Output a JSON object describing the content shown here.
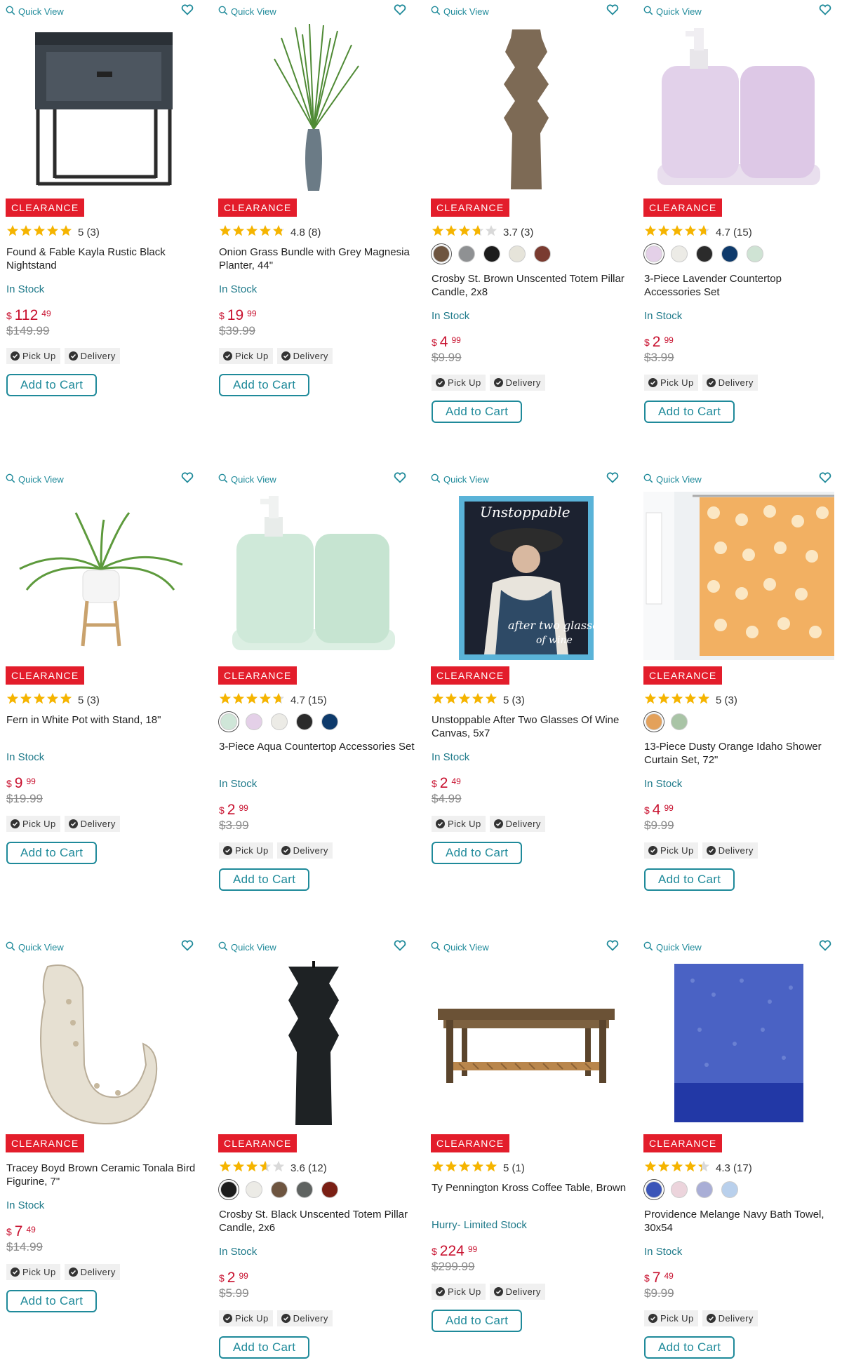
{
  "ui": {
    "quick_view": "Quick View",
    "badge": "CLEARANCE",
    "pickup": "Pick Up",
    "delivery": "Delivery",
    "add_to_cart": "Add to Cart",
    "currency": "$",
    "colors": {
      "accent": "#1f8a9a",
      "sale": "#e31d2b",
      "price": "#c8102e",
      "star": "#f5b400"
    }
  },
  "products": [
    {
      "name": "Found & Fable Kayla Rustic Black Nightstand",
      "rating": 5,
      "rating_text": "5 (3)",
      "swatches": [],
      "stock": "In Stock",
      "price_dollars": "112",
      "price_cents": "49",
      "was": "$149.99",
      "image": "nightstand"
    },
    {
      "name": "Onion Grass Bundle with Grey Magnesia Planter, 44\"",
      "rating": 4.8,
      "rating_text": "4.8 (8)",
      "swatches": [],
      "stock": "In Stock",
      "price_dollars": "19",
      "price_cents": "99",
      "was": "$39.99",
      "image": "grass"
    },
    {
      "name": "Crosby St. Brown Unscented Totem Pillar Candle, 2x8",
      "rating": 3.7,
      "rating_text": "3.7 (3)",
      "swatches": [
        "#6e5540",
        "#8f9193",
        "#1c1c1c",
        "#e6e4da",
        "#7a3b30"
      ],
      "stock": "In Stock",
      "price_dollars": "4",
      "price_cents": "99",
      "was": "$9.99",
      "image": "candle-brown"
    },
    {
      "name": "3-Piece Lavender Countertop Accessories Set",
      "rating": 4.7,
      "rating_text": "4.7 (15)",
      "swatches": [
        "#e4d0e8",
        "#ecebe6",
        "#2b2b2b",
        "#0e3a6b",
        "#cfe3d4"
      ],
      "stock": "In Stock",
      "price_dollars": "2",
      "price_cents": "99",
      "was": "$3.99",
      "image": "set-lavender"
    },
    {
      "name": "Fern in White Pot with Stand, 18\"",
      "rating": 5,
      "rating_text": "5 (3)",
      "swatches": [],
      "stock": "In Stock",
      "price_dollars": "9",
      "price_cents": "99",
      "was": "$19.99",
      "image": "fern"
    },
    {
      "name": "3-Piece Aqua Countertop Accessories Set",
      "rating": 4.7,
      "rating_text": "4.7 (15)",
      "swatches": [
        "#cfe6d8",
        "#e4d0e8",
        "#ecebe6",
        "#2b2b2b",
        "#0e3a6b"
      ],
      "stock": "In Stock",
      "price_dollars": "2",
      "price_cents": "99",
      "was": "$3.99",
      "image": "set-aqua"
    },
    {
      "name": "Unstoppable After Two Glasses Of Wine Canvas, 5x7",
      "rating": 5,
      "rating_text": "5 (3)",
      "swatches": [],
      "stock": "In Stock",
      "price_dollars": "2",
      "price_cents": "49",
      "was": "$4.99",
      "image": "canvas",
      "canvas_text_1": "Unstoppable",
      "canvas_text_2": "after two glasses",
      "canvas_text_3": "of wine"
    },
    {
      "name": "13-Piece Dusty Orange Idaho Shower Curtain Set, 72\"",
      "rating": 5,
      "rating_text": "5 (3)",
      "swatches": [
        "#e3a15b",
        "#a9c4a6"
      ],
      "stock": "In Stock",
      "price_dollars": "4",
      "price_cents": "99",
      "was": "$9.99",
      "image": "curtain"
    },
    {
      "name": "Tracey Boyd Brown Ceramic Tonala Bird Figurine, 7\"",
      "rating": 0,
      "rating_text": "",
      "swatches": [],
      "stock": "In Stock",
      "price_dollars": "7",
      "price_cents": "49",
      "was": "$14.99",
      "image": "bird"
    },
    {
      "name": "Crosby St. Black Unscented Totem Pillar Candle, 2x6",
      "rating": 3.6,
      "rating_text": "3.6 (12)",
      "swatches": [
        "#1c1c1c",
        "#ecebe6",
        "#6e5540",
        "#5f6361",
        "#7a1f14"
      ],
      "stock": "In Stock",
      "price_dollars": "2",
      "price_cents": "99",
      "was": "$5.99",
      "image": "candle-black"
    },
    {
      "name": "Ty Pennington Kross Coffee Table, Brown",
      "rating": 5,
      "rating_text": "5 (1)",
      "swatches": [],
      "stock": "Hurry- Limited Stock",
      "price_dollars": "224",
      "price_cents": "99",
      "was": "$299.99",
      "image": "table"
    },
    {
      "name": "Providence Melange Navy Bath Towel, 30x54",
      "rating": 4.3,
      "rating_text": "4.3 (17)",
      "swatches": [
        "#3b55b8",
        "#ecd4dc",
        "#a9aed6",
        "#b9d0ec"
      ],
      "stock": "In Stock",
      "price_dollars": "7",
      "price_cents": "49",
      "was": "$9.99",
      "image": "towel"
    }
  ]
}
